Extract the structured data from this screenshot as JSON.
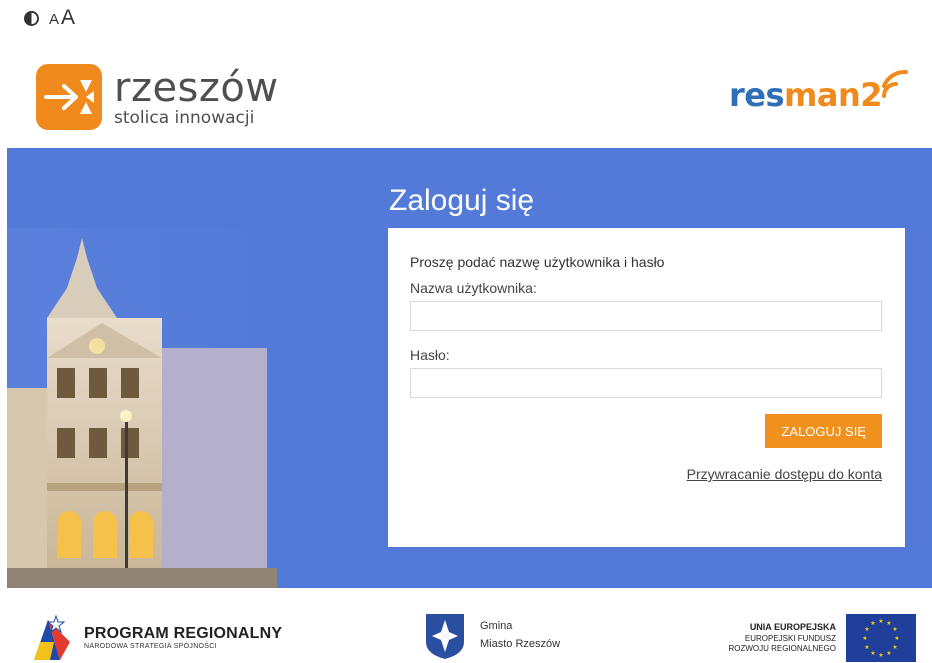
{
  "accessibility": {
    "contrast_icon": "contrast-icon",
    "font_small": "A",
    "font_large": "A"
  },
  "header": {
    "city_logo": {
      "name": "rzeszów",
      "tagline": "stolica innowacji"
    },
    "app_logo": {
      "part1": "res",
      "part2": "man2"
    }
  },
  "login": {
    "title": "Zaloguj się",
    "instruction": "Proszę podać nazwę użytkownika i hasło",
    "username_label": "Nazwa użytkownika:",
    "username_value": "",
    "password_label": "Hasło:",
    "password_value": "",
    "submit_label": "ZALOGUJ SIĘ",
    "recover_link": "Przywracanie dostępu do konta"
  },
  "footer": {
    "program": {
      "title": "PROGRAM REGIONALNY",
      "subtitle": "NARODOWA STRATEGIA SPÓJNOŚCI"
    },
    "gmina": {
      "line1": "Gmina",
      "line2": "Miasto Rzeszów"
    },
    "eu": {
      "title": "UNIA EUROPEJSKA",
      "line1": "EUROPEJSKI FUNDUSZ",
      "line2": "ROZWOJU REGIONALNEGO"
    }
  },
  "colors": {
    "hero_bg": "#537ad9",
    "accent": "#f0901d",
    "resman_blue": "#2f6fb8",
    "resman_orange": "#f08a1c"
  }
}
